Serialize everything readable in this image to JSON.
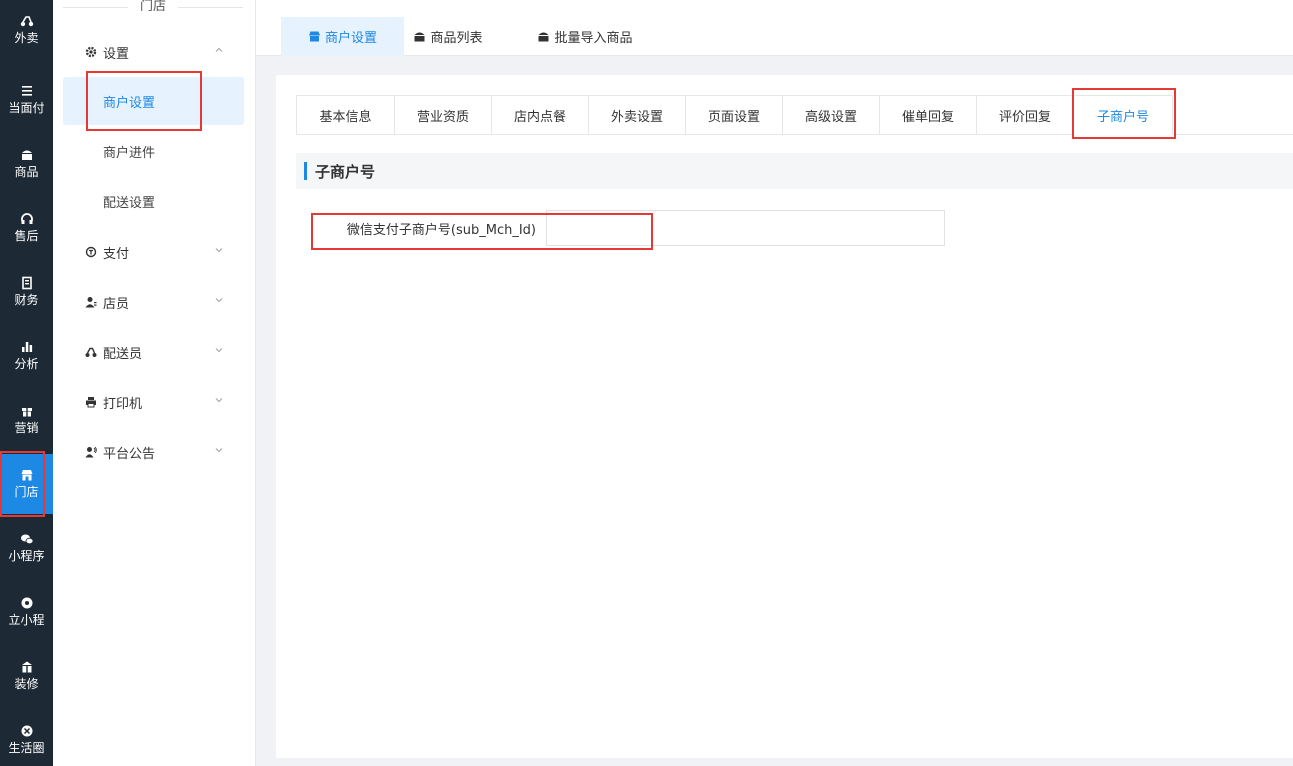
{
  "rail": [
    {
      "label": "外卖",
      "icon": "scooter-icon"
    },
    {
      "label": "当面付",
      "icon": "list-icon"
    },
    {
      "label": "商品",
      "icon": "product-icon"
    },
    {
      "label": "售后",
      "icon": "headset-icon"
    },
    {
      "label": "财务",
      "icon": "finance-icon"
    },
    {
      "label": "分析",
      "icon": "bar-chart-icon"
    },
    {
      "label": "营销",
      "icon": "gift-icon"
    },
    {
      "label": "门店",
      "icon": "store-icon",
      "active": true
    },
    {
      "label": "小程序",
      "icon": "wechat-icon"
    },
    {
      "label": "立小程",
      "icon": "miniapp-icon"
    },
    {
      "label": "装修",
      "icon": "decorate-icon"
    },
    {
      "label": "生活圈",
      "icon": "circle-icon"
    }
  ],
  "sidebar": {
    "title": "门店",
    "settings_group": "设置",
    "sub_items": [
      "商户设置",
      "商户进件",
      "配送设置"
    ],
    "groups": [
      "支付",
      "店员",
      "配送员",
      "打印机",
      "平台公告"
    ]
  },
  "top_tabs": [
    "商户设置",
    "商品列表",
    "批量导入商品"
  ],
  "inner_tabs": [
    "基本信息",
    "营业资质",
    "店内点餐",
    "外卖设置",
    "页面设置",
    "高级设置",
    "催单回复",
    "评价回复",
    "子商户号"
  ],
  "section_title": "子商户号",
  "form": {
    "label": "微信支付子商户号(sub_Mch_Id)",
    "value": ""
  },
  "colors": {
    "accent": "#1e88e5",
    "rail_bg": "#1d2a36",
    "highlight": "#e53935"
  }
}
